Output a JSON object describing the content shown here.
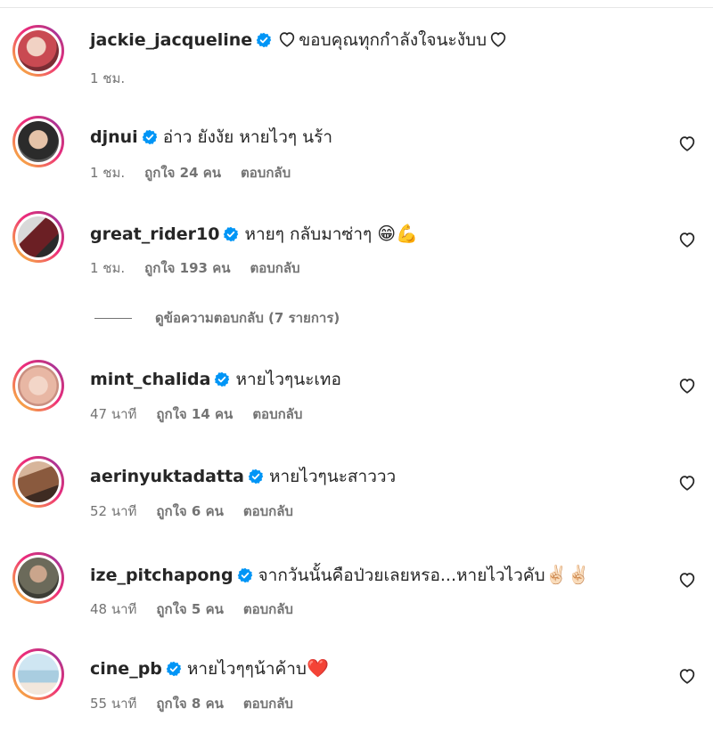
{
  "comments": [
    {
      "username": "jackie_jacqueline",
      "text": "ขอบคุณทุกกำลังใจนะงับบ",
      "time": "1 ชม.",
      "likes": "",
      "reply": "",
      "avatar_color": "#c94a52"
    },
    {
      "username": "djnui",
      "text": "อ่าว ยังงัย หายไวๆ นร้า",
      "time": "1 ชม.",
      "likes": "ถูกใจ 24 คน",
      "reply": "ตอบกลับ",
      "avatar_color": "#3a3a3a"
    },
    {
      "username": "great_rider10",
      "text": "หายๆ กลับมาซ่าๆ",
      "emoji": "😁💪",
      "time": "1 ชม.",
      "likes": "ถูกใจ 193 คน",
      "reply": "ตอบกลับ",
      "avatar_color": "#5a2b2b"
    },
    {
      "username": "mint_chalida",
      "text": "หายไวๆนะเทอ",
      "time": "47 นาที",
      "likes": "ถูกใจ 14 คน",
      "reply": "ตอบกลับ",
      "avatar_color": "#e8c7b6"
    },
    {
      "username": "aerinyuktadatta",
      "text": "หายไวๆนะสาววว",
      "time": "52 นาที",
      "likes": "ถูกใจ 6 คน",
      "reply": "ตอบกลับ",
      "avatar_color": "#8a5a3e"
    },
    {
      "username": "ize_pitchapong",
      "text": "จากวันนั้นคือป่วยเลยหรอ...หายไวไวคับ",
      "emoji": "✌🏻✌🏻",
      "time": "48 นาที",
      "likes": "ถูกใจ 5 คน",
      "reply": "ตอบกลับ",
      "avatar_color": "#6b6a5a"
    },
    {
      "username": "cine_pb",
      "text": "หายไวๆๆน้าค้าบ",
      "emoji": "❤️",
      "time": "55 นาที",
      "likes": "ถูกใจ 8 คน",
      "reply": "ตอบกลับ",
      "avatar_color": "#a9cde0"
    }
  ],
  "view_replies": "ดูข้อความตอบกลับ (7 รายการ)",
  "colors": {
    "verified": "#0095f6",
    "secondary_text": "#737373",
    "heart_emoji": "#e0245e"
  },
  "icons": {
    "verified": "verified-badge-icon",
    "like": "heart-outline-icon"
  }
}
